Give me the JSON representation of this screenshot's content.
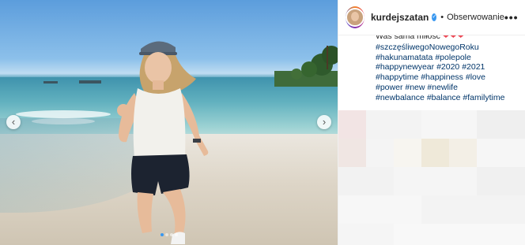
{
  "post": {
    "username": "kurdejszatan",
    "separator": "•",
    "follow_label": "Obserwowanie",
    "more_label": "•••",
    "prev_arrow": "‹",
    "next_arrow": "›",
    "verified_icon": "✓",
    "caption_first": "Was sama miłość",
    "caption_hearts": "❤❤❤",
    "hashtag_lines": [
      [
        "#szczęśliwegoNowegoRoku"
      ],
      [
        "#hakunamatata",
        "#polepole"
      ],
      [
        "#happynewyear",
        "#2020",
        "#2021"
      ],
      [
        "#happytime",
        "#happiness",
        "#love"
      ],
      [
        "#power",
        "#new",
        "#newlife"
      ],
      [
        "#newbalance",
        "#balance",
        "#familytime"
      ]
    ],
    "carousel_dots": 4,
    "active_dot": 0
  },
  "colors": {
    "hashtag": "#003569",
    "verified": "#3897f0",
    "hearts": "#ed4956"
  }
}
